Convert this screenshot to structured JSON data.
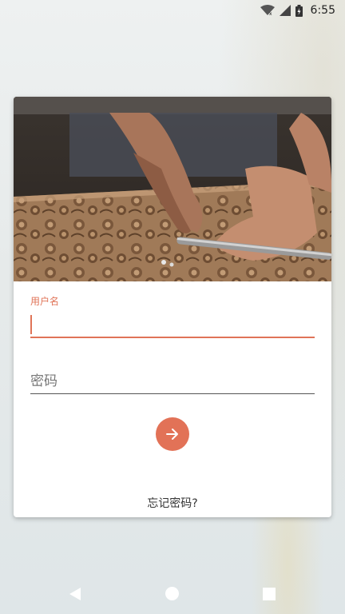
{
  "status_bar": {
    "time": "6:55",
    "icons": [
      "wifi-icon",
      "signal-icon",
      "battery-icon"
    ]
  },
  "login_card": {
    "hero_image": "woodcarving-hands-photo",
    "username_label": "用户名",
    "username_value": "",
    "password_placeholder": "密码",
    "password_value": "",
    "submit_icon": "arrow-right-icon",
    "forgot_link": "忘记密码?"
  },
  "nav_bar": {
    "icons": [
      "back-icon",
      "home-icon",
      "recents-icon"
    ]
  },
  "colors": {
    "accent": "#e27257",
    "card": "#ffffff",
    "background": "#e6eaea"
  }
}
